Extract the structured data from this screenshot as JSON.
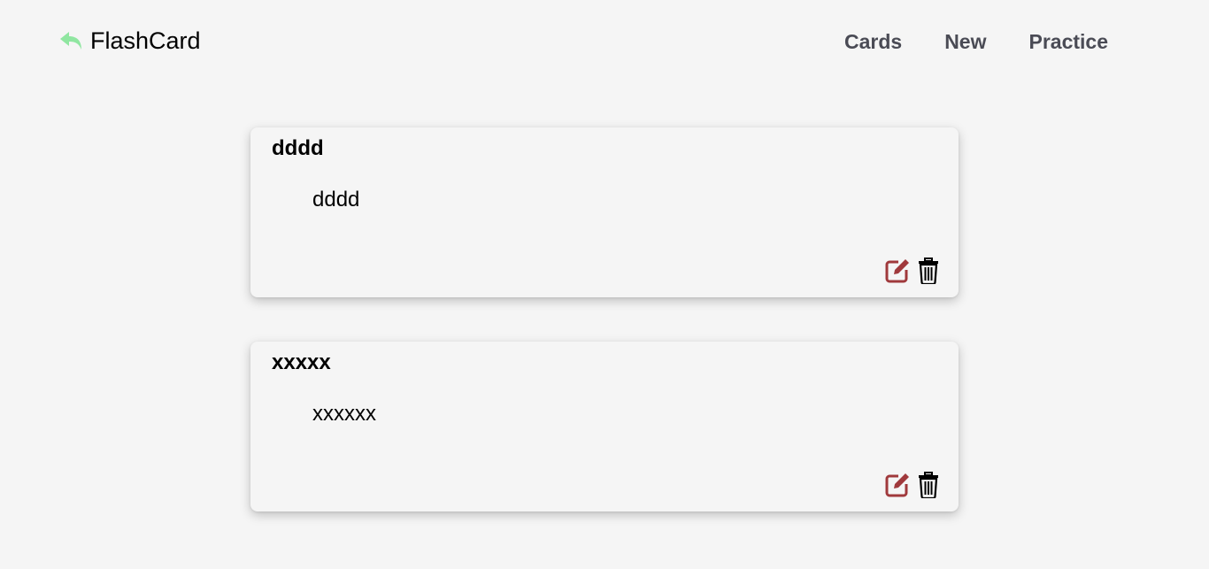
{
  "header": {
    "brand": "FlashCard",
    "brand_icon": "reply-arrow-icon",
    "brand_icon_color": "#90e6a1",
    "nav": [
      "Cards",
      "New",
      "Practice"
    ],
    "nav_color": "#4a4b55"
  },
  "cards": [
    {
      "title": "dddd",
      "body": "dddd"
    },
    {
      "title": "xxxxx",
      "body": "xxxxxx"
    }
  ],
  "icons": {
    "edit": "edit-icon",
    "edit_color": "#a0393c",
    "delete": "trash-icon",
    "delete_color": "#000000"
  }
}
